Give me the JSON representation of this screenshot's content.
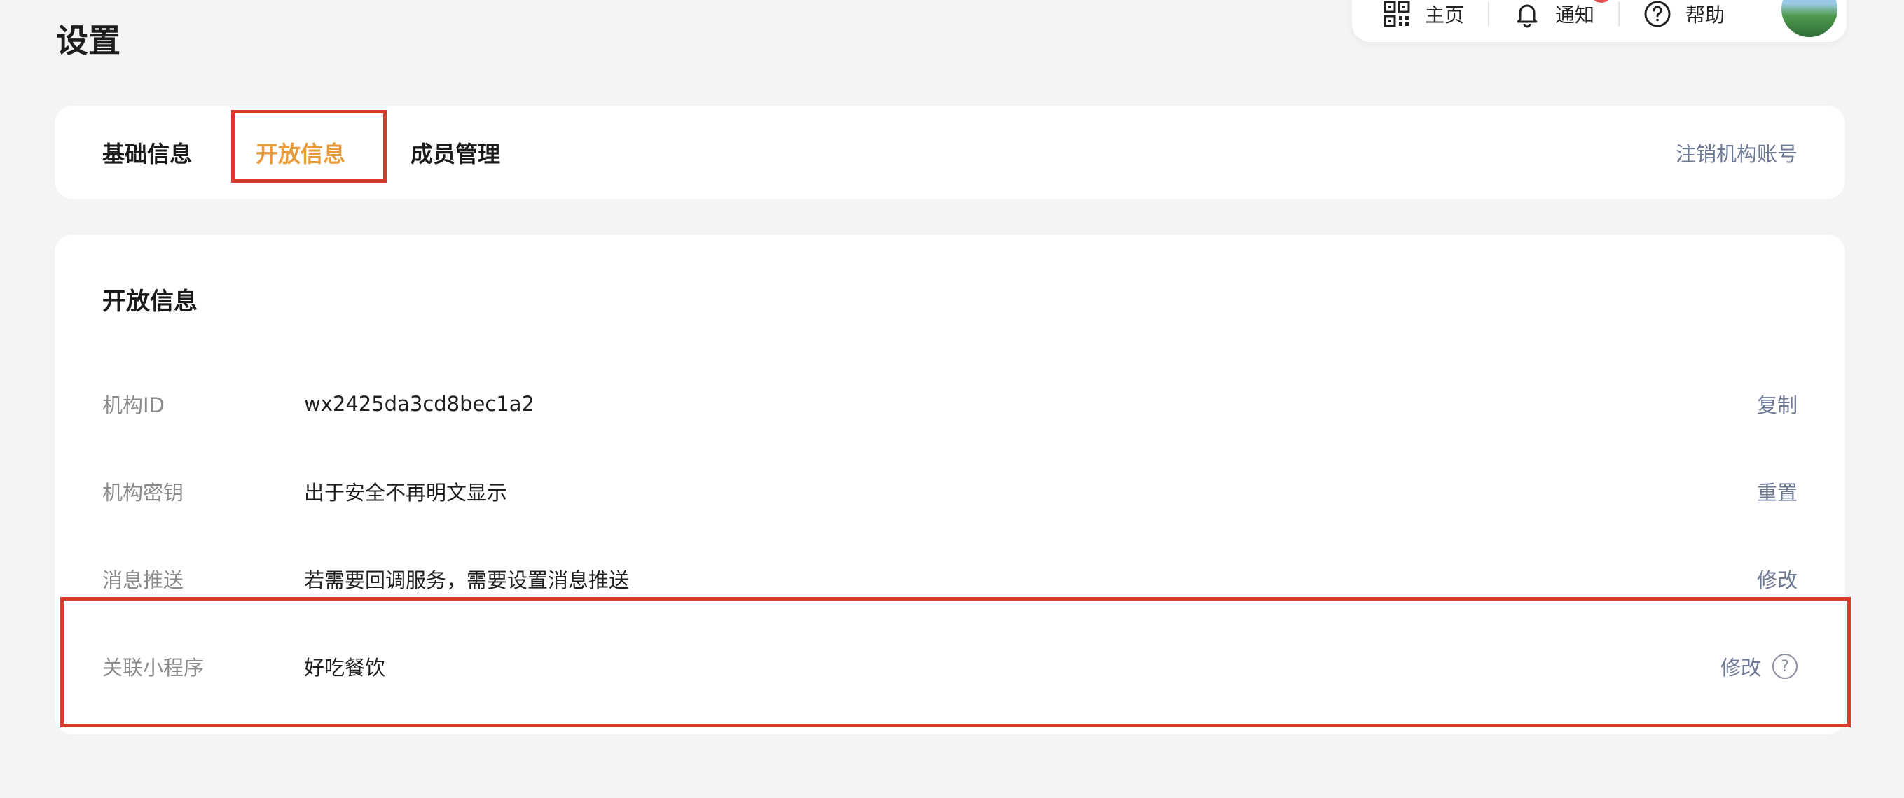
{
  "page": {
    "title": "设置"
  },
  "topbar": {
    "home_label": "主页",
    "notify_label": "通知",
    "help_label": "帮助"
  },
  "tabs": [
    {
      "label": "基础信息",
      "active": false
    },
    {
      "label": "开放信息",
      "active": true
    },
    {
      "label": "成员管理",
      "active": false
    }
  ],
  "cancel_account_label": "注销机构账号",
  "section": {
    "title": "开放信息",
    "rows": [
      {
        "label": "机构ID",
        "value": "wx2425da3cd8bec1a2",
        "action": "复制"
      },
      {
        "label": "机构密钥",
        "value": "出于安全不再明文显示",
        "action": "重置"
      },
      {
        "label": "消息推送",
        "value": "若需要回调服务，需要设置消息推送",
        "action": "修改"
      },
      {
        "label": "关联小程序",
        "value": "好吃餐饮",
        "action": "修改"
      }
    ]
  },
  "colors": {
    "accent": "#e79a3a",
    "link": "#6c7894",
    "highlight_border": "#d93a2e",
    "badge": "#e55050"
  }
}
